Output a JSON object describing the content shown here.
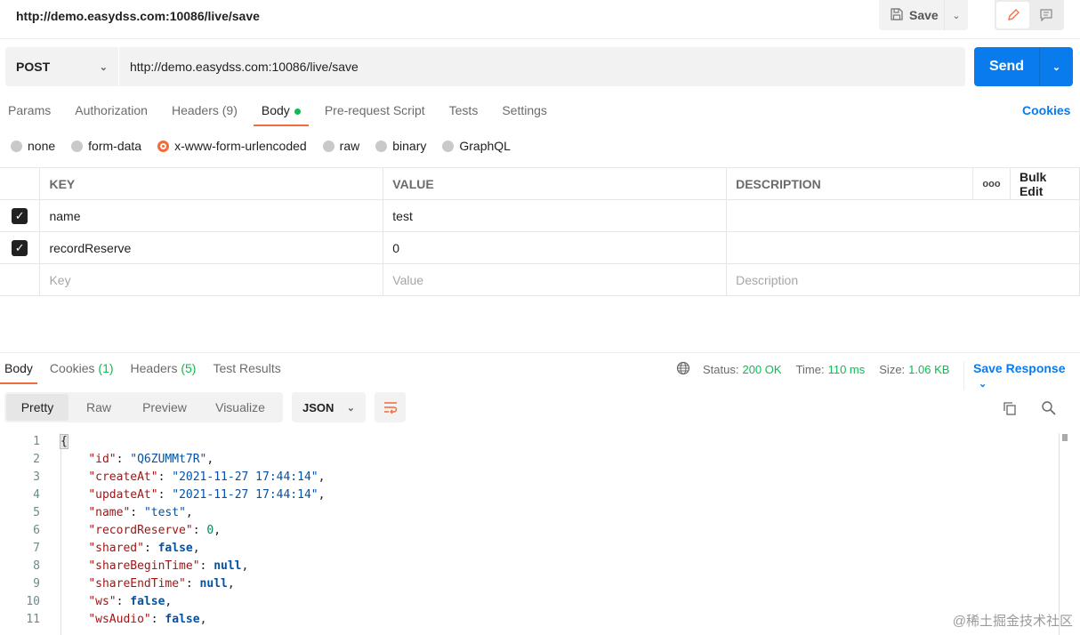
{
  "header": {
    "title": "http://demo.easydss.com:10086/live/save",
    "save_label": "Save"
  },
  "request": {
    "method": "POST",
    "url": "http://demo.easydss.com:10086/live/save",
    "send_label": "Send"
  },
  "request_tabs": [
    {
      "label": "Params"
    },
    {
      "label": "Authorization"
    },
    {
      "label": "Headers",
      "count": "(9)"
    },
    {
      "label": "Body"
    },
    {
      "label": "Pre-request Script"
    },
    {
      "label": "Tests"
    },
    {
      "label": "Settings"
    }
  ],
  "cookies_link": "Cookies",
  "body_types": [
    {
      "label": "none"
    },
    {
      "label": "form-data"
    },
    {
      "label": "x-www-form-urlencoded"
    },
    {
      "label": "raw"
    },
    {
      "label": "binary"
    },
    {
      "label": "GraphQL"
    }
  ],
  "params_table": {
    "headers": {
      "key": "KEY",
      "value": "VALUE",
      "description": "DESCRIPTION",
      "bulk_edit": "Bulk Edit",
      "more": "ooo"
    },
    "rows": [
      {
        "key": "name",
        "value": "test",
        "checked": true
      },
      {
        "key": "recordReserve",
        "value": "0",
        "checked": true
      }
    ],
    "placeholders": {
      "key": "Key",
      "value": "Value",
      "description": "Description"
    }
  },
  "response_tabs": [
    {
      "label": "Body"
    },
    {
      "label": "Cookies",
      "count": "(1)"
    },
    {
      "label": "Headers",
      "count": "(5)"
    },
    {
      "label": "Test Results"
    }
  ],
  "response_status": {
    "status_label": "Status:",
    "status": "200 OK",
    "time_label": "Time:",
    "time": "110 ms",
    "size_label": "Size:",
    "size": "1.06 KB",
    "save_response": "Save Response"
  },
  "view_modes": [
    "Pretty",
    "Raw",
    "Preview",
    "Visualize"
  ],
  "format": "JSON",
  "code_lines": [
    {
      "n": "1",
      "k": "",
      "v": "{"
    },
    {
      "n": "2",
      "k": "\"id\"",
      "v": "\"Q6ZUMMt7R\"",
      "t": "s"
    },
    {
      "n": "3",
      "k": "\"createAt\"",
      "v": "\"2021-11-27 17:44:14\"",
      "t": "s"
    },
    {
      "n": "4",
      "k": "\"updateAt\"",
      "v": "\"2021-11-27 17:44:14\"",
      "t": "s"
    },
    {
      "n": "5",
      "k": "\"name\"",
      "v": "\"test\"",
      "t": "s"
    },
    {
      "n": "6",
      "k": "\"recordReserve\"",
      "v": "0",
      "t": "n"
    },
    {
      "n": "7",
      "k": "\"shared\"",
      "v": "false",
      "t": "b"
    },
    {
      "n": "8",
      "k": "\"shareBeginTime\"",
      "v": "null",
      "t": "b"
    },
    {
      "n": "9",
      "k": "\"shareEndTime\"",
      "v": "null",
      "t": "b"
    },
    {
      "n": "10",
      "k": "\"ws\"",
      "v": "false",
      "t": "b"
    },
    {
      "n": "11",
      "k": "\"wsAudio\"",
      "v": "false",
      "t": "b"
    }
  ],
  "watermark": "@稀土掘金技术社区",
  "colors": {
    "accent": "#f26b3a",
    "primary": "#097bed",
    "success": "#0cbb52"
  }
}
